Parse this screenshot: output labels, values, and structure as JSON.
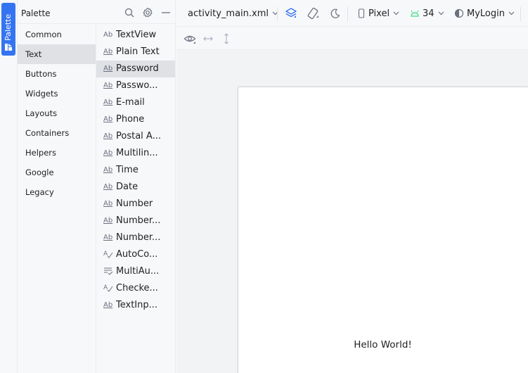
{
  "strip": {
    "tab_label": "Palette",
    "tab_icon": "palette-icon"
  },
  "palette": {
    "title": "Palette",
    "header_icons": [
      "search-icon",
      "gear-icon",
      "minimize-icon"
    ],
    "categories": [
      "Common",
      "Text",
      "Buttons",
      "Widgets",
      "Layouts",
      "Containers",
      "Helpers",
      "Google",
      "Legacy"
    ],
    "selected_category": "Text",
    "widgets": [
      {
        "icon": "Ab",
        "label": "TextView"
      },
      {
        "icon": "Ab",
        "label": "Plain Text"
      },
      {
        "icon": "Ab",
        "label": "Password"
      },
      {
        "icon": "Ab",
        "label": "Passwo..."
      },
      {
        "icon": "Ab",
        "label": "E-mail"
      },
      {
        "icon": "Ab",
        "label": "Phone"
      },
      {
        "icon": "Ab",
        "label": "Postal A..."
      },
      {
        "icon": "Ab",
        "label": "Multilin..."
      },
      {
        "icon": "Ab",
        "label": "Time"
      },
      {
        "icon": "Ab",
        "label": "Date"
      },
      {
        "icon": "Ab",
        "label": "Number"
      },
      {
        "icon": "Ab",
        "label": "Number..."
      },
      {
        "icon": "Ab",
        "label": "Number..."
      },
      {
        "icon": "autocomplete-icon",
        "label": "AutoCo..."
      },
      {
        "icon": "multiautocomplete-icon",
        "label": "MultiAu..."
      },
      {
        "icon": "checkedtext-icon",
        "label": "Checke..."
      },
      {
        "icon": "Ab",
        "label": "TextInp..."
      }
    ],
    "selected_widget": "Password"
  },
  "toolbar": {
    "file": "activity_main.xml",
    "device": "Pixel",
    "api_level": "34",
    "theme": "MyLogin",
    "accent": "#3574f0",
    "android_green": "#3ddc84"
  },
  "preview": {
    "text": "Hello World!"
  }
}
